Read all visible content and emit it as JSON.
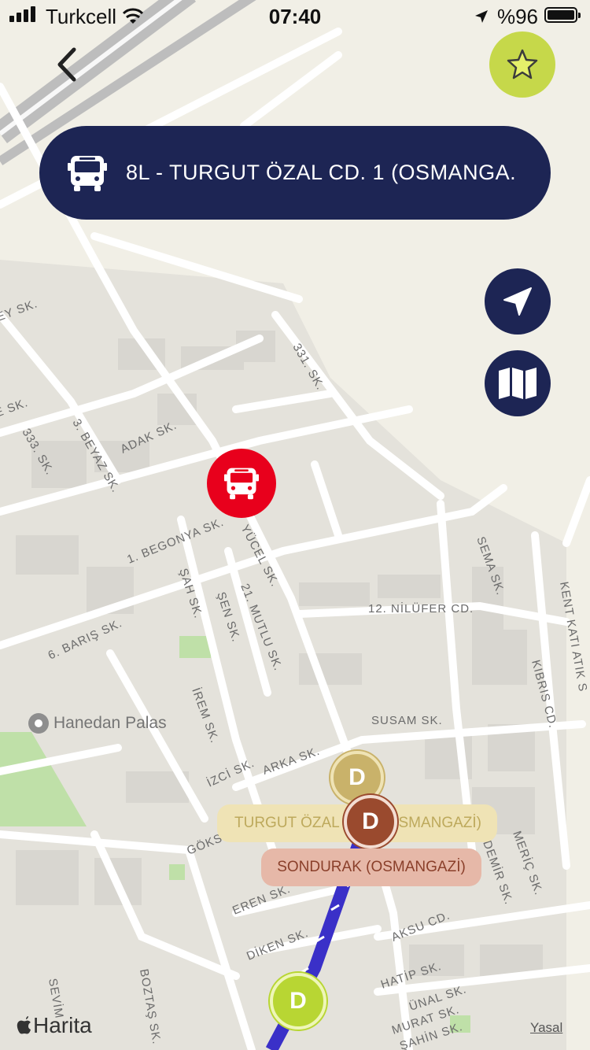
{
  "status_bar": {
    "carrier": "Turkcell",
    "time": "07:40",
    "battery": "%96"
  },
  "route": {
    "title": "8L - TURGUT ÖZAL CD. 1 (OSMANGA..."
  },
  "streets": [
    "EY SK.",
    "331. SK.",
    "E SK.",
    "333. SK.",
    "3. BEYAZ SK.",
    "ADAK SK.",
    "1. BEGONYA SK.",
    "YÜCEL SK.",
    "ŞAH SK.",
    "ŞEN SK.",
    "21. MUTLU SK.",
    "6. BARIŞ SK.",
    "12. NİLÜFER CD.",
    "SEMA SK.",
    "KENT KATI ATIK S",
    "KIBRIS CD.",
    "SUSAM SK.",
    "İREM SK.",
    "İZCİ SK.",
    "ARKA SK.",
    "GÖKS",
    "EREN SK.",
    "DİKEN SK.",
    "AKSU CD.",
    "DEMİR SK.",
    "MERİÇ SK.",
    "HATİP SK.",
    "ÜNAL SK.",
    "MURAT SK.",
    "ŞAHİN SK.",
    "SEVİM",
    "BOZTAŞ SK."
  ],
  "poi": {
    "name": "Hanedan Palas"
  },
  "stops": {
    "label_1": "TURGUT ÖZAL",
    "label_1_tail": "SMANGAZİ)",
    "label_2": "SONDURAK (OSMANGAZİ)",
    "stop_letter": "D"
  },
  "map": {
    "attribution": "Harita",
    "legal": "Yasal"
  },
  "colors": {
    "navy": "#1d2554",
    "accent_lime": "#c6d84a",
    "bus_red": "#e8001c",
    "stop_gold": "#c9b26a",
    "stop_brown": "#9a4a2e",
    "route_line": "#3a30c8"
  }
}
